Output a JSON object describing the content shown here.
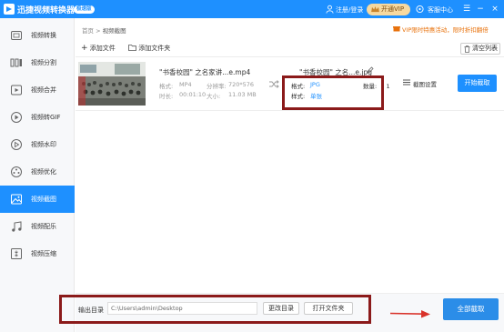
{
  "app": {
    "title": "迅捷视频转换器",
    "edition": "极速版"
  },
  "titlebar": {
    "login": "注册/登录",
    "vip": "开通VIP",
    "message_center": "客服中心",
    "minimize": "一",
    "menu": "☰",
    "restore": "−",
    "close": "×"
  },
  "sidebar": {
    "items": [
      {
        "label": "视频转换",
        "icon": "video-convert-icon"
      },
      {
        "label": "视频分割",
        "icon": "video-split-icon"
      },
      {
        "label": "视频合并",
        "icon": "video-merge-icon"
      },
      {
        "label": "视频转GIF",
        "icon": "video-gif-icon"
      },
      {
        "label": "视频水印",
        "icon": "video-watermark-icon"
      },
      {
        "label": "视频优化",
        "icon": "video-optimize-icon"
      },
      {
        "label": "视频截图",
        "icon": "video-screenshot-icon"
      },
      {
        "label": "视频配乐",
        "icon": "video-music-icon"
      },
      {
        "label": "视频压缩",
        "icon": "video-compress-icon"
      }
    ],
    "active_index": 6
  },
  "breadcrumb": {
    "home": "首页",
    "separator": ">",
    "current": "视频截图"
  },
  "promo": "VIP限时特惠活动，限时折扣翻倍",
  "toolbar": {
    "add_file": "添加文件",
    "add_folder": "添加文件夹",
    "clear_list": "清空列表"
  },
  "file": {
    "source_name": "\"书香校园\" 之名家讲...e.mp4",
    "format_label": "格式:",
    "format_value": "MP4",
    "resolution_label": "分辨率:",
    "resolution_value": "720*576",
    "duration_label": "时长:",
    "duration_value": "00:01:10",
    "size_label": "大小:",
    "size_value": "11.03 MB",
    "output_name": "\"书香校园\" 之名...e.jpg",
    "out_format_label": "格式:",
    "out_format_value": "JPG",
    "out_count_label": "数量:",
    "out_count_value": "1",
    "out_style_label": "样式:",
    "out_style_value": "单张",
    "snapshot_settings": "截图设置",
    "start_button": "开始截取"
  },
  "bottom": {
    "output_dir_label": "输出目录",
    "output_dir_value": "C:\\Users\\admin\\Desktop",
    "change_dir": "更改目录",
    "open_folder": "打开文件夹",
    "all_button": "全部截取"
  },
  "colors": {
    "brand": "#1e90ff",
    "highlight_box": "#8b1a1a",
    "arrow": "#d9322a",
    "promo": "#e8720c"
  }
}
